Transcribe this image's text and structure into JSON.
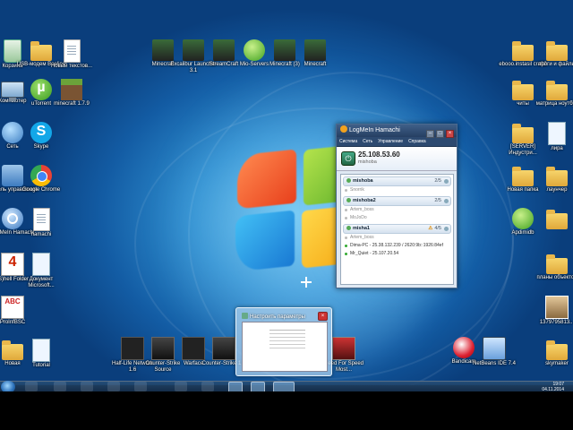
{
  "desktop": {
    "icons_left": [
      {
        "label": "Корзина",
        "icon": "recycle-bin-icon",
        "type": "recycle"
      },
      {
        "label": "USB-модем Beeline",
        "icon": "usb-modem-icon",
        "type": "folder"
      },
      {
        "label": "Новый текстов...",
        "icon": "text-document-icon",
        "type": "doc"
      },
      {
        "label": "Компьютер",
        "icon": "computer-icon",
        "type": "computer"
      },
      {
        "label": "uTorrent",
        "icon": "utorrent-icon",
        "type": "torrent"
      },
      {
        "label": "minecraft 1.7.9",
        "icon": "minecraft-icon",
        "type": "mc"
      },
      {
        "label": "Сеть",
        "icon": "network-icon",
        "type": "network"
      },
      {
        "label": "Skype",
        "icon": "skype-icon",
        "type": "skype"
      },
      {
        "label": "Панель управления",
        "icon": "control-panel-icon",
        "type": "panel"
      },
      {
        "label": "Google Chrome",
        "icon": "chrome-icon",
        "type": "chrome"
      },
      {
        "label": "LogMeIn Hamachi",
        "icon": "hamachi-icon",
        "type": "hamachi"
      },
      {
        "label": "hamachi",
        "icon": "text-document-icon",
        "type": "doc"
      },
      {
        "label": "(S)hell Folder",
        "icon": "xsec-icon",
        "type": "xsec"
      },
      {
        "label": "Документ Microsoft...",
        "icon": "word-document-icon",
        "type": "blue-doc"
      },
      {
        "label": "ProInfBSC",
        "icon": "abc-icon",
        "type": "abc"
      },
      {
        "label": "Новая",
        "icon": "folder-icon",
        "type": "folder"
      },
      {
        "label": "Tutorial",
        "icon": "document-icon",
        "type": "blue-doc"
      }
    ],
    "icons_top": [
      {
        "label": "Minecraft",
        "icon": "minecraft-icon",
        "type": "mc2"
      },
      {
        "label": "Excalibur Launcher 3.1",
        "icon": "launcher-icon",
        "type": "mc2"
      },
      {
        "label": "StreamCraft",
        "icon": "streamcraft-icon",
        "type": "mc2"
      },
      {
        "label": "Mio-Servers",
        "icon": "green-figure-icon",
        "type": "green-app"
      },
      {
        "label": "Minecraft (3)",
        "icon": "minecraft-icon",
        "type": "mc2"
      },
      {
        "label": "Minecraft",
        "icon": "minecraft-icon",
        "type": "mc2"
      }
    ],
    "icons_bottom": [
      {
        "label": "Half-Life Network 1.6",
        "icon": "half-life-icon",
        "type": "dark"
      },
      {
        "label": "Counter-Strike Source",
        "icon": "cs-icon",
        "type": "dark2"
      },
      {
        "label": "Warface",
        "icon": "warface-icon",
        "type": "dark"
      },
      {
        "label": "Counter-Strike 1.6",
        "icon": "cs-icon",
        "type": "dark2"
      },
      {
        "label": "Need For Speed Most...",
        "icon": "nfs-icon",
        "type": "nfs"
      },
      {
        "label": "Bandicam",
        "icon": "bandicam-icon",
        "type": "ball"
      },
      {
        "label": "NetBeans IDE 7.4",
        "icon": "netbeans-icon",
        "type": "box"
      }
    ],
    "icons_right": [
      {
        "label": "ebooo.instasil craft2",
        "icon": "folder-icon",
        "type": "folder"
      },
      {
        "label": "проги и файлы",
        "icon": "folder-icon",
        "type": "folder"
      },
      {
        "label": "читы",
        "icon": "folder-icon",
        "type": "folder"
      },
      {
        "label": "матрица ноутбук",
        "icon": "folder-icon",
        "type": "folder"
      },
      {
        "label": "[SERVER] Индустри...",
        "icon": "folder-icon",
        "type": "folder"
      },
      {
        "label": "лира",
        "icon": "document-icon",
        "type": "blue-doc"
      },
      {
        "label": "Новая папка",
        "icon": "folder-icon",
        "type": "folder"
      },
      {
        "label": "лаунчер",
        "icon": "folder-icon",
        "type": "folder"
      },
      {
        "label": "Apdimidb",
        "icon": "green-app-icon",
        "type": "green-app"
      },
      {
        "label": "",
        "icon": "folder-icon",
        "type": "folder"
      },
      {
        "label": "планы объектов",
        "icon": "folder-icon",
        "type": "folder"
      },
      {
        "label": "1379795813...",
        "icon": "photo-icon",
        "type": "photo"
      },
      {
        "label": "skymaker",
        "icon": "folder-icon",
        "type": "folder"
      }
    ]
  },
  "hamachi": {
    "title": "LogMeIn Hamachi",
    "menu": [
      "Система",
      "Сеть",
      "Управление",
      "Справка"
    ],
    "ip": "25.108.53.60",
    "nickname": "mishoba",
    "networks": [
      {
        "name": "mishoba",
        "count": "2/5",
        "warn": "",
        "peers": [
          {
            "name": "Snorrik",
            "online": false
          }
        ]
      },
      {
        "name": "mishoba2",
        "count": "2/5",
        "warn": "",
        "peers": [
          {
            "name": "Artem_boss",
            "online": false
          },
          {
            "name": "MoJoDo",
            "online": false
          }
        ]
      },
      {
        "name": "misha1",
        "count": "4/5",
        "warn": "⚠",
        "peers": [
          {
            "name": "Artem_boss",
            "online": false
          },
          {
            "name": "Dima-PC - 25.38.132.239 / 2620:9b::1926:84ef",
            "online": true
          },
          {
            "name": "Mr_Quiet - 25.107.20.54",
            "online": true
          }
        ]
      }
    ]
  },
  "taskbar_thumbnail": {
    "title": "Настроить параметры"
  },
  "clock": {
    "time": "19:07",
    "date": "04.11.2014"
  }
}
